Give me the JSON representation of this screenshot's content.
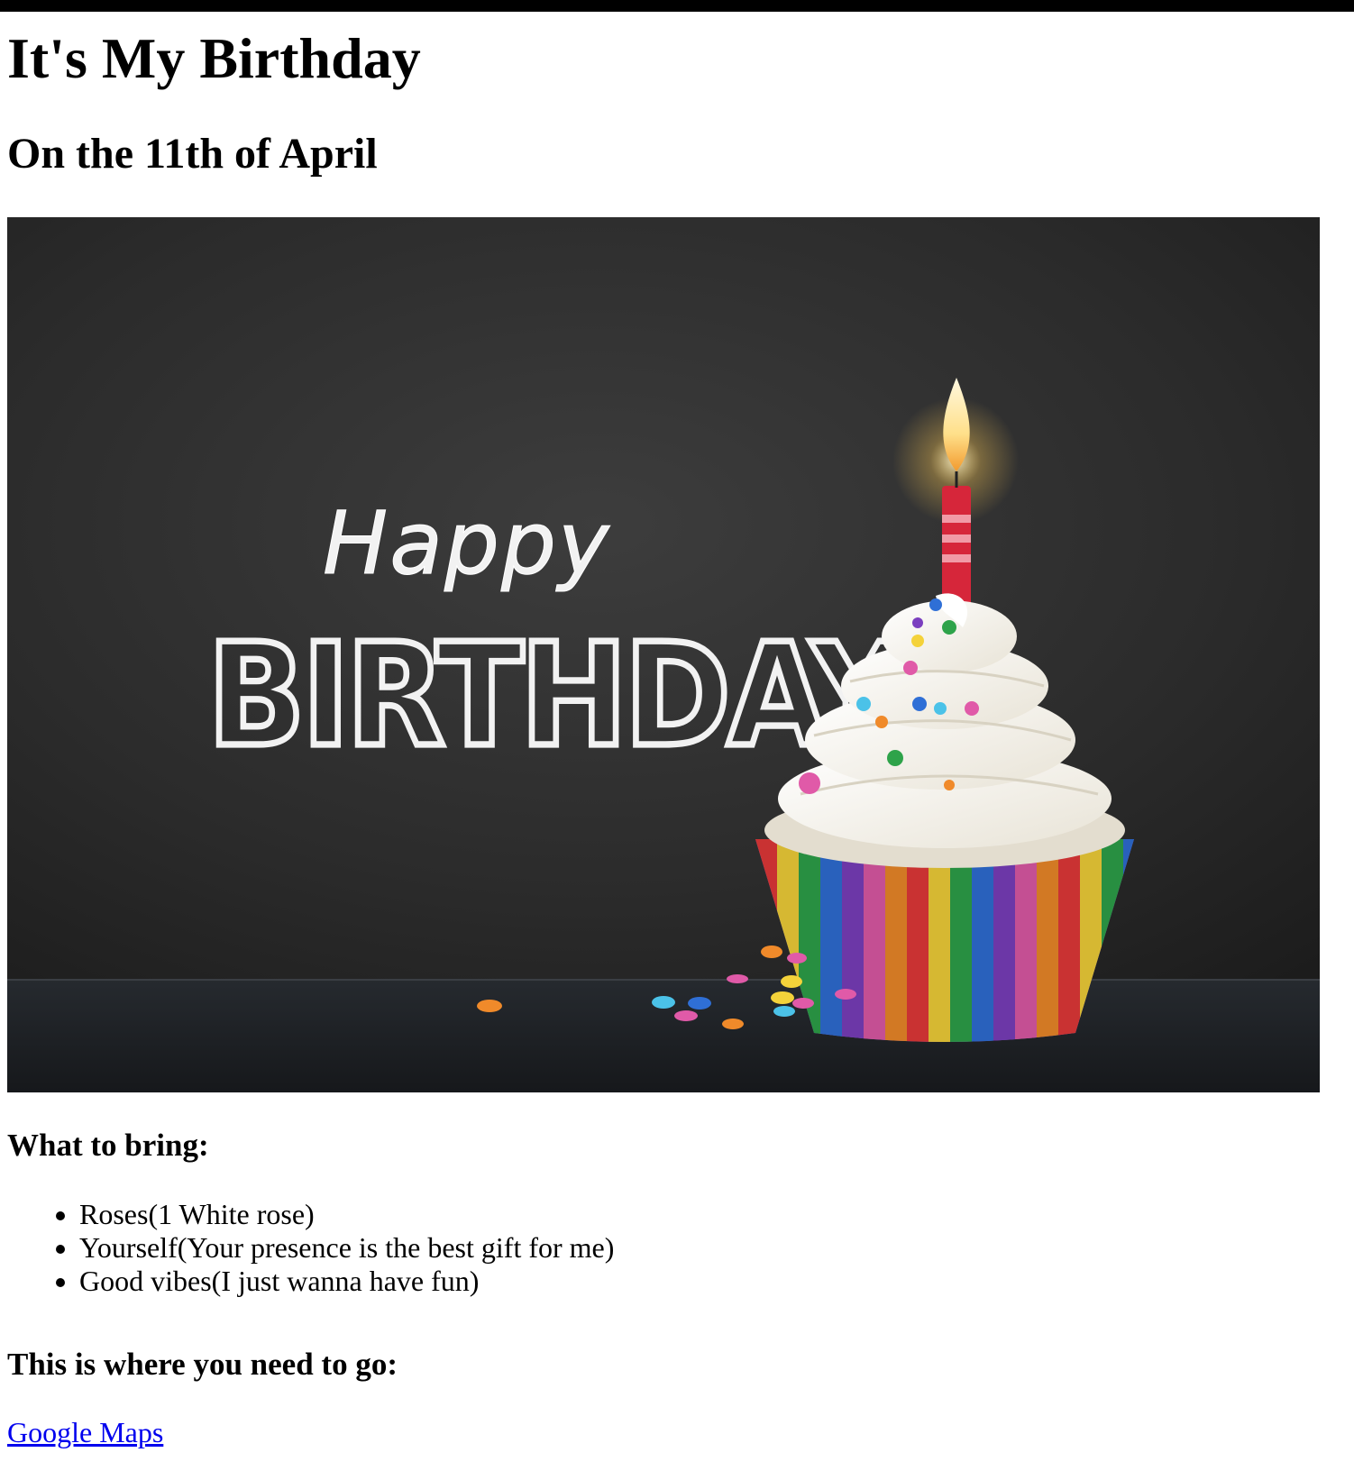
{
  "page": {
    "title": "It's My Birthday",
    "subtitle": "On the 11th of April"
  },
  "hero": {
    "happy": "Happy",
    "birthday": "BIRTHDAY"
  },
  "bring": {
    "heading": "What to bring:",
    "items": [
      {
        "label": "Roses(1 White rose)"
      },
      {
        "label": "Yourself(Your presence is the best gift for me)"
      },
      {
        "label": "Good vibes(I just wanna have fun)"
      }
    ]
  },
  "location": {
    "heading": "This is where you need to go:",
    "link_label": "Google Maps"
  },
  "colors": {
    "background": "#ffffff",
    "text": "#000000",
    "link": "#0000ee",
    "chalkboard": "#2a2a2a"
  }
}
